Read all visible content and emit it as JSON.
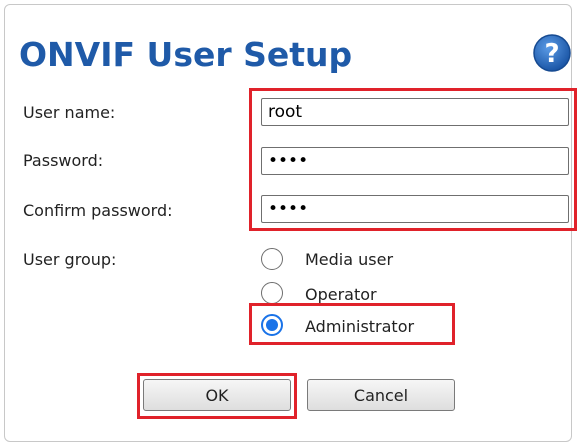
{
  "dialog": {
    "title": "ONVIF User Setup",
    "help_icon": "help-question-icon"
  },
  "form": {
    "username_label": "User name:",
    "username_value": "root",
    "password_label": "Password:",
    "password_value": "••••",
    "confirm_label": "Confirm password:",
    "confirm_value": "••••",
    "group_label": "User group:",
    "groups": [
      {
        "label": "Media user",
        "checked": false
      },
      {
        "label": "Operator",
        "checked": false
      },
      {
        "label": "Administrator",
        "checked": true
      }
    ]
  },
  "buttons": {
    "ok": "OK",
    "cancel": "Cancel"
  },
  "colors": {
    "title": "#1f5aa8",
    "highlight": "#e0222a",
    "radio_selected": "#1a73e8"
  }
}
